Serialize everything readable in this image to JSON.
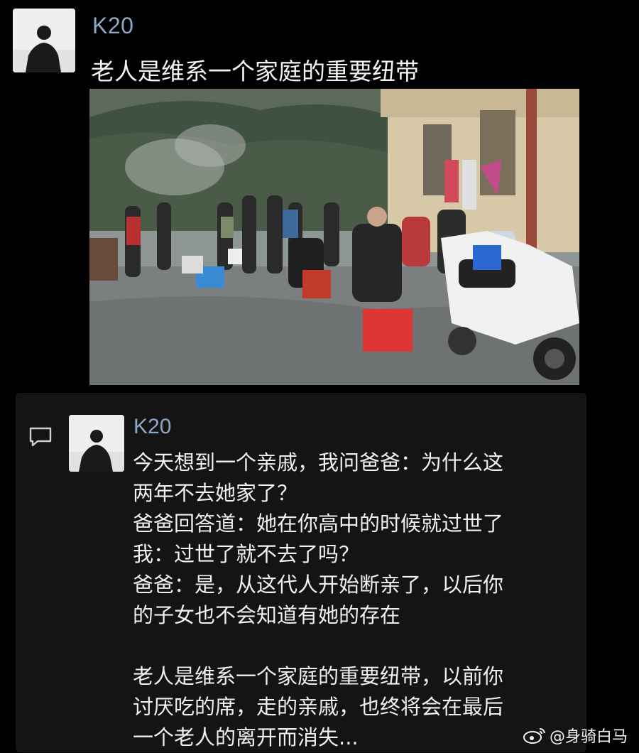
{
  "post": {
    "username": "K20",
    "title": "老人是维系一个家庭的重要纽带"
  },
  "comment": {
    "username": "K20",
    "lines": [
      "今天想到一个亲戚，我问爸爸：为什么这",
      "两年不去她家了？",
      "爸爸回答道：她在你高中的时候就过世了",
      "我：过世了就不去了吗？",
      "爸爸：是，从这代人开始断亲了，以后你",
      "的子女也不会知道有她的存在",
      "",
      "老人是维系一个家庭的重要纽带，以前你",
      "讨厌吃的席，走的亲戚，也终将会在最后",
      "一个老人的离开而消失..."
    ]
  },
  "watermark": {
    "text": "@身骑白马"
  },
  "icons": {
    "comment": "comment-bubble-icon",
    "weibo": "weibo-logo-icon"
  },
  "colors": {
    "background": "#000000",
    "card": "#141414",
    "username": "#8fa7c4",
    "text": "#f0f0f0"
  }
}
